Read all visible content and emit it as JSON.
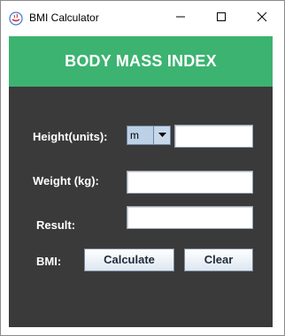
{
  "window": {
    "title": "BMI Calculator",
    "icon": "java-coffee-icon",
    "controls": {
      "minimize": "minimize-icon",
      "maximize": "maximize-icon",
      "close": "close-icon"
    }
  },
  "header": {
    "title": "BODY MASS INDEX",
    "background_color": "#3cb371"
  },
  "form": {
    "height_label": "Height(units):",
    "unit_selected": "m",
    "height_value": "",
    "weight_label": "Weight (kg):",
    "weight_value": "",
    "result_label": "Result:",
    "result_value": "",
    "bmi_label": "BMI:",
    "calculate_label": "Calculate",
    "clear_label": "Clear",
    "panel_color": "#3a3a3a"
  }
}
